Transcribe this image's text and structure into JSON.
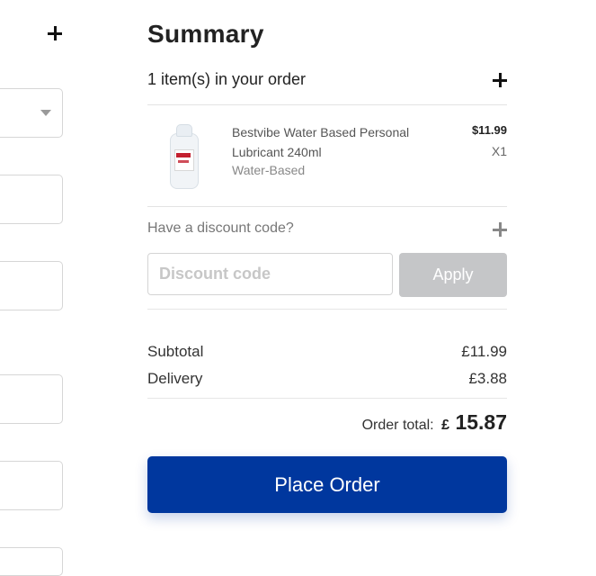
{
  "summary": {
    "title": "Summary",
    "items_in_order": "1 item(s) in your order"
  },
  "product": {
    "name": "Bestvibe Water Based Personal Lubricant 240ml",
    "variant": "Water-Based",
    "price": "$11.99",
    "quantity": "X1"
  },
  "discount": {
    "label": "Have a discount code?",
    "placeholder": "Discount code",
    "apply_label": "Apply"
  },
  "totals": {
    "subtotal_label": "Subtotal",
    "subtotal_value": "£11.99",
    "delivery_label": "Delivery",
    "delivery_value": "£3.88",
    "order_total_label": "Order total:",
    "currency": "£",
    "order_total_value": "15.87"
  },
  "actions": {
    "place_order_label": "Place Order"
  },
  "icons": {
    "expand_items": "plus-icon",
    "expand_discount": "plus-icon",
    "select_caret": "chevron-down-icon",
    "left_plus": "plus-icon"
  },
  "colors": {
    "primary": "#00379e",
    "apply_disabled": "#c5c6c8"
  }
}
